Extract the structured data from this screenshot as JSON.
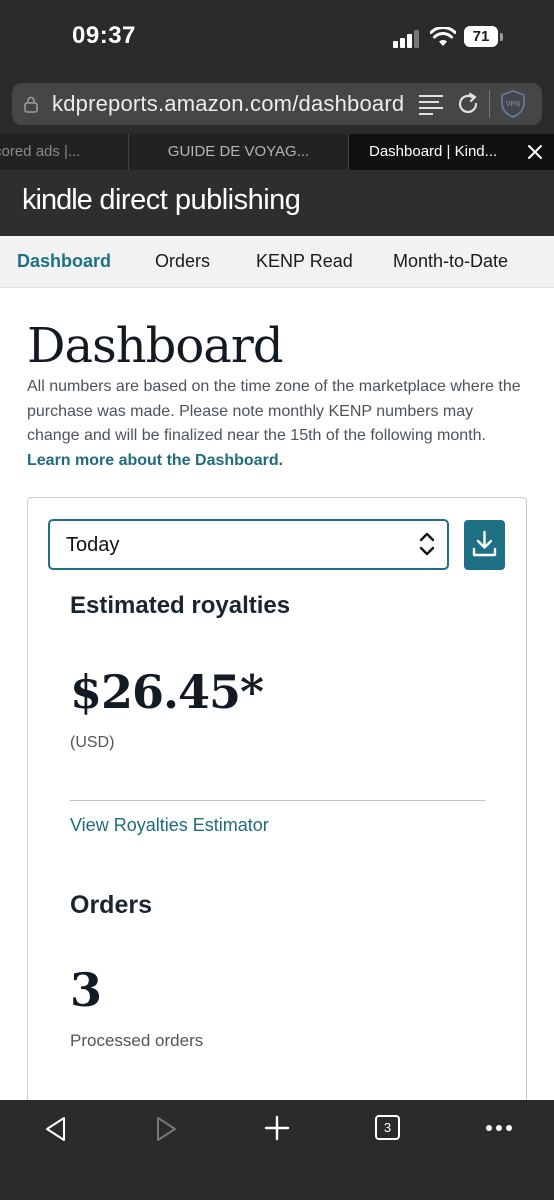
{
  "status_bar": {
    "time": "09:37",
    "battery": "71"
  },
  "browser": {
    "url": "kdpreports.amazon.com/dashboard",
    "tabs": [
      {
        "label": "cored ads |..."
      },
      {
        "label": "GUIDE DE VOYAG..."
      },
      {
        "label": "Dashboard | Kind..."
      }
    ],
    "tab_count": "3"
  },
  "kdp": {
    "logo_bold": "kindle",
    "logo_rest": "direct publishing"
  },
  "nav": {
    "items": [
      {
        "label": "Dashboard"
      },
      {
        "label": "Orders"
      },
      {
        "label": "KENP Read"
      },
      {
        "label": "Month-to-Date"
      }
    ]
  },
  "page": {
    "title": "Dashboard",
    "intro": "All numbers are based on the time zone of the marketplace where the purchase was made. Please note monthly KENP numbers may change and will be finalized near the 15th of the following month.",
    "intro_link": "Learn more about the Dashboard."
  },
  "card": {
    "period": "Today",
    "royalties_heading": "Estimated royalties",
    "royalties_value": "$26.45*",
    "royalties_currency": "(USD)",
    "estimator_link": "View Royalties Estimator",
    "orders_heading": "Orders",
    "orders_value": "3",
    "orders_caption": "Processed orders"
  },
  "colors": {
    "accent": "#1e7084",
    "link": "#1e6b7d",
    "chrome": "#2b2b2b"
  }
}
